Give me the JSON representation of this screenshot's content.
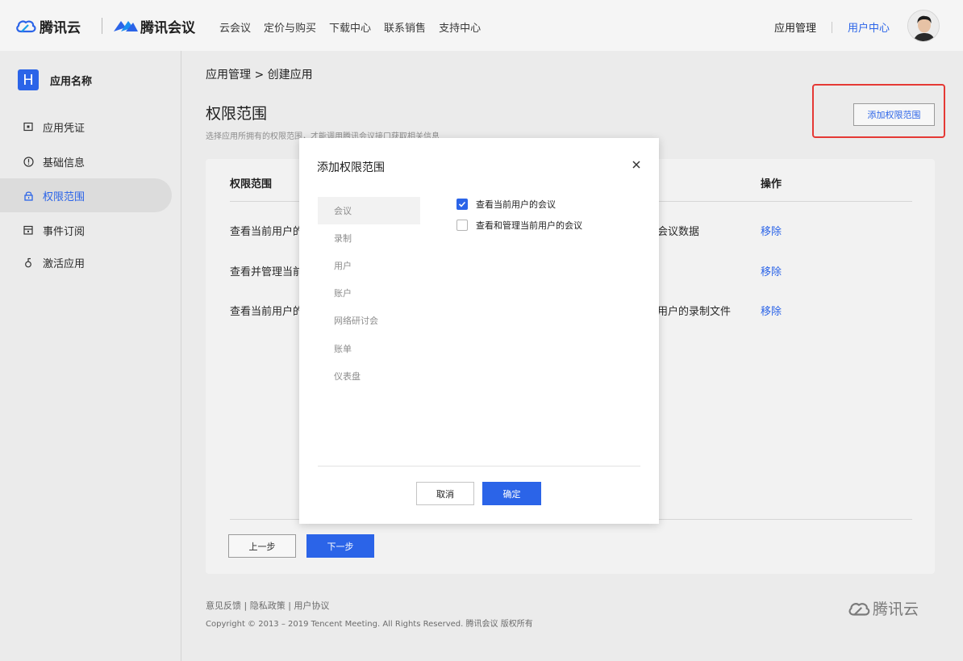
{
  "topnav": {
    "brand_cloud": "腾讯云",
    "brand_meeting": "腾讯会议",
    "links": [
      "云会议",
      "定价与购买",
      "下载中心",
      "联系销售",
      "支持中心"
    ],
    "app_management": "应用管理",
    "user_center": "用户中心"
  },
  "sidebar": {
    "app_badge": "H",
    "app_name": "应用名称",
    "items": [
      {
        "label": "应用凭证",
        "icon": "credential-icon"
      },
      {
        "label": "基础信息",
        "icon": "info-circle-icon"
      },
      {
        "label": "权限范围",
        "icon": "lock-icon",
        "active": true
      },
      {
        "label": "事件订阅",
        "icon": "calendar-icon"
      },
      {
        "label": "激活应用",
        "icon": "activate-icon"
      }
    ]
  },
  "main": {
    "breadcrumb": "应用管理 > 创建应用",
    "title": "权限范围",
    "description": "选择应用所拥有的权限范围，才能调用腾讯会议接口获取相关信息",
    "add_scope_label": "添加权限范围",
    "table": {
      "headers": {
        "scope": "权限范围",
        "action": "操作"
      },
      "rows": [
        {
          "scope": "查看当前用户的",
          "desc": "会议数据",
          "action": "移除"
        },
        {
          "scope": "查看并管理当前",
          "desc": "",
          "action": "移除"
        },
        {
          "scope": "查看当前用户的",
          "desc": "用户的录制文件",
          "action": "移除"
        }
      ]
    },
    "prev_label": "上一步",
    "next_label": "下一步"
  },
  "footer": {
    "links": "意见反馈 | 隐私政策 | 用户协议",
    "copyright": "Copyright © 2013 – 2019 Tencent Meeting. All Rights Reserved.  腾讯会议 版权所有",
    "brand": "腾讯云"
  },
  "modal": {
    "title": "添加权限范围",
    "categories": [
      "会议",
      "录制",
      "用户",
      "账户",
      "网络研讨会",
      "账单",
      "仪表盘"
    ],
    "active_category": "会议",
    "options": [
      {
        "label": "查看当前用户的会议",
        "checked": true
      },
      {
        "label": "查看和管理当前用户的会议",
        "checked": false
      }
    ],
    "cancel_label": "取消",
    "ok_label": "确定"
  },
  "colors": {
    "accent": "#2b64e8",
    "highlight": "#e53935"
  }
}
